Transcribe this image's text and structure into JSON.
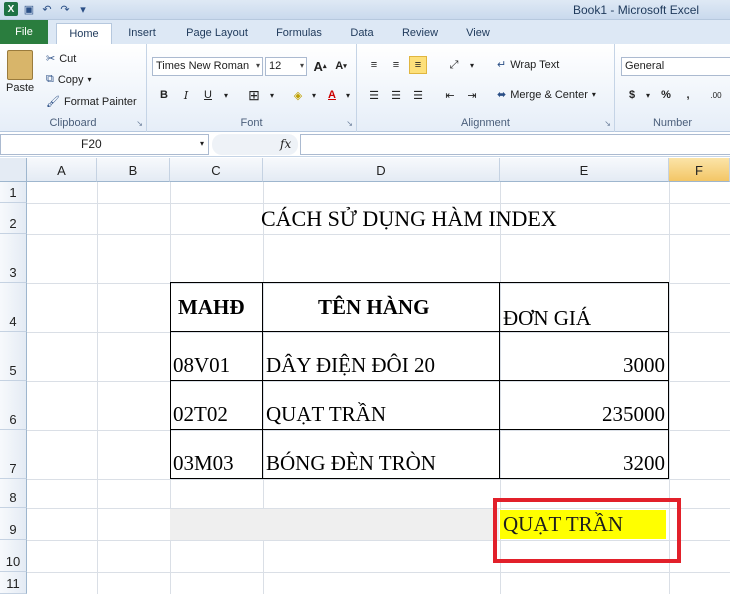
{
  "window": {
    "title": "Book1  -  Microsoft Excel"
  },
  "tabs": [
    "File",
    "Home",
    "Insert",
    "Page Layout",
    "Formulas",
    "Data",
    "Review",
    "View"
  ],
  "ribbon": {
    "clipboard": {
      "label": "Clipboard",
      "paste": "Paste",
      "cut": "Cut",
      "copy": "Copy",
      "format_painter": "Format Painter"
    },
    "font": {
      "label": "Font",
      "font_name": "Times New Roman",
      "font_size": "12"
    },
    "alignment": {
      "label": "Alignment",
      "wrap_text": "Wrap Text",
      "merge_center": "Merge & Center"
    },
    "number": {
      "label": "Number",
      "format": "General",
      "currency": "$",
      "percent": "%",
      "comma": ","
    }
  },
  "formula_bar": {
    "name_box": "F20",
    "fx": "fx",
    "value": ""
  },
  "columns": [
    "A",
    "B",
    "C",
    "D",
    "E",
    "F"
  ],
  "rows": [
    "1",
    "2",
    "3",
    "4",
    "5",
    "6",
    "7",
    "8",
    "9",
    "10",
    "11"
  ],
  "sheet": {
    "title": "CÁCH SỬ DỤNG HÀM INDEX",
    "headers": {
      "code": "MAHĐ",
      "name": "TÊN HÀNG",
      "price": "ĐƠN GIÁ"
    },
    "items": [
      {
        "code": "08V01",
        "name": "DÂY ĐIỆN ĐÔI 20",
        "price": "3000"
      },
      {
        "code": "02T02",
        "name": "QUẠT TRẦN",
        "price": "235000"
      },
      {
        "code": "03M03",
        "name": "BÓNG ĐÈN TRÒN",
        "price": "3200"
      }
    ],
    "result": "QUẠT TRẦN"
  },
  "colors": {
    "file_tab": "#2a7d3e",
    "highlight": "#ffff00",
    "annotation": "#e2202a",
    "selected_header": "#f3c666"
  }
}
